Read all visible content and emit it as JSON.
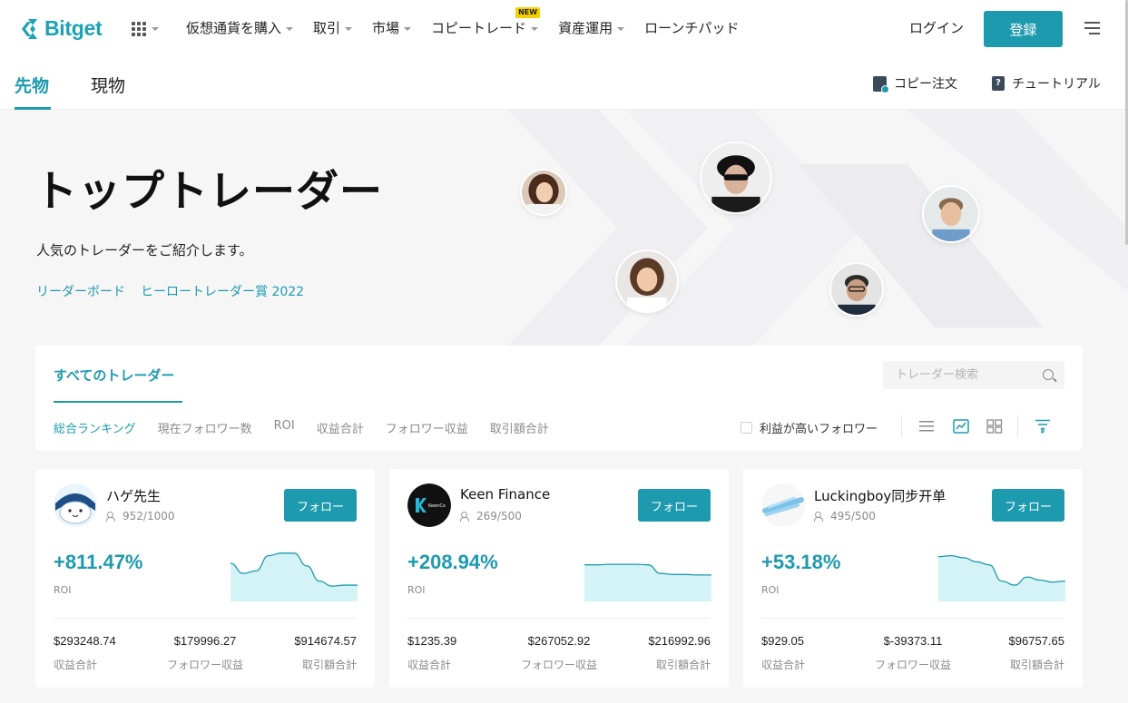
{
  "header": {
    "logo": "Bitget",
    "nav": [
      {
        "label": "仮想通貨を購入",
        "dropdown": true
      },
      {
        "label": "取引",
        "dropdown": true
      },
      {
        "label": "市場",
        "dropdown": true
      },
      {
        "label": "コピートレード",
        "dropdown": true,
        "badge": "NEW"
      },
      {
        "label": "資産運用",
        "dropdown": true
      },
      {
        "label": "ローンチパッド",
        "dropdown": false
      }
    ],
    "login": "ログイン",
    "register": "登録"
  },
  "subheader": {
    "tabs": [
      "先物",
      "現物"
    ],
    "active_tab": "先物",
    "copy_order": "コピー注文",
    "tutorial": "チュートリアル"
  },
  "hero": {
    "title": "トップトレーダー",
    "subtitle": "人気のトレーダーをご紹介します。",
    "links": [
      "リーダーボード",
      "ヒーロートレーダー賞 2022"
    ]
  },
  "panel": {
    "tab": "すべてのトレーダー",
    "search_placeholder": "トレーダー検索",
    "sorts": [
      "総合ランキング",
      "現在フォロワー数",
      "ROI",
      "収益合計",
      "フォロワー収益",
      "取引額合計"
    ],
    "active_sort": "総合ランキング",
    "checkbox_label": "利益が高いフォロワー"
  },
  "cards": [
    {
      "name": "ハゲ先生",
      "followers": "952/1000",
      "follow": "フォロー",
      "roi": "+811.47%",
      "roi_label": "ROI",
      "stats": [
        {
          "value": "$293248.74",
          "label": "収益合計"
        },
        {
          "value": "$179996.27",
          "label": "フォロワー収益"
        },
        {
          "value": "$914674.57",
          "label": "取引額合計"
        }
      ],
      "trend": [
        0.75,
        0.55,
        0.6,
        0.9,
        0.95,
        0.95,
        0.7,
        0.4,
        0.3,
        0.32,
        0.32
      ]
    },
    {
      "name": "Keen Finance",
      "followers": "269/500",
      "follow": "フォロー",
      "roi": "+208.94%",
      "roi_label": "ROI",
      "stats": [
        {
          "value": "$1235.39",
          "label": "収益合計"
        },
        {
          "value": "$267052.92",
          "label": "フォロワー収益"
        },
        {
          "value": "$216992.96",
          "label": "取引額合計"
        }
      ],
      "trend": [
        0.72,
        0.72,
        0.73,
        0.73,
        0.73,
        0.72,
        0.55,
        0.53,
        0.53,
        0.52,
        0.52
      ]
    },
    {
      "name": "Luckingboy同步开单",
      "followers": "495/500",
      "follow": "フォロー",
      "roi": "+53.18%",
      "roi_label": "ROI",
      "stats": [
        {
          "value": "$929.05",
          "label": "収益合計"
        },
        {
          "value": "$-39373.11",
          "label": "フォロワー収益"
        },
        {
          "value": "$96757.65",
          "label": "取引額合計"
        }
      ],
      "trend": [
        0.88,
        0.9,
        0.86,
        0.78,
        0.72,
        0.4,
        0.32,
        0.48,
        0.42,
        0.38,
        0.4
      ]
    }
  ],
  "colors": {
    "accent": "#1e9aaf",
    "chart_fill": "#d4f3f6",
    "chart_line": "#1e9aaf"
  }
}
